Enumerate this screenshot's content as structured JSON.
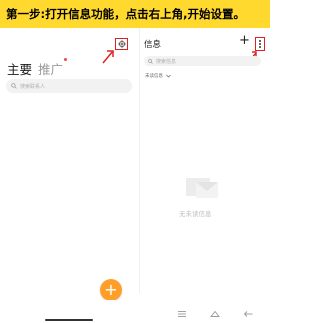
{
  "banner": {
    "text": "第一步:打开信息功能，点击右上角,开始设置。"
  },
  "left_panel": {
    "tab_main": "主要",
    "tab_promo": "推广",
    "search_placeholder": "搜索联系人"
  },
  "right_panel": {
    "title": "信息",
    "search_placeholder": "搜索信息",
    "filter_label": "未读信息",
    "empty_text": "无未读信息"
  },
  "icons": {
    "settings": "gear-icon",
    "add": "plus-icon",
    "more": "kebab-icon",
    "compose": "plus-icon",
    "annotation": "red-arrow-icon"
  },
  "colors": {
    "banner_bg": "#FFD92E",
    "fab": "#FF9F2A",
    "annotation": "#DD2222"
  }
}
